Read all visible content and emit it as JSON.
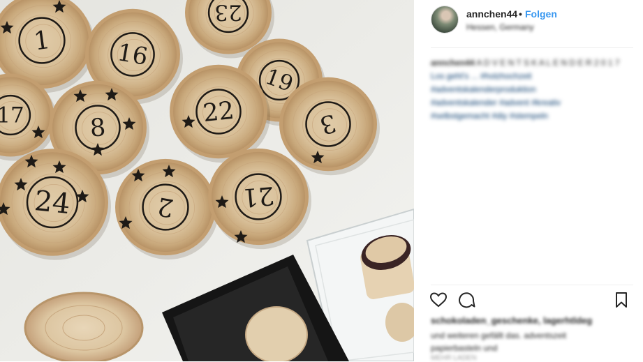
{
  "photo": {
    "alt_semantic": "wooden advent calendar number discs with stamp and ink pad"
  },
  "discs": [
    {
      "number": "1"
    },
    {
      "number": "16"
    },
    {
      "number": "23"
    },
    {
      "number": "19"
    },
    {
      "number": "17"
    },
    {
      "number": "8"
    },
    {
      "number": "22"
    },
    {
      "number": "3"
    },
    {
      "number": "24"
    },
    {
      "number": "2"
    },
    {
      "number": "21"
    }
  ],
  "header": {
    "username": "annchen44",
    "separator": "•",
    "follow_label": "Folgen",
    "location": "Hessen, Germany"
  },
  "caption": {
    "username": "annchen44",
    "title": "A D V E N T S K A L E N D E R 2 0 1 7",
    "lines": [
      "Los geht's ... #holzhochzeit",
      "#adventskalenderproduktion",
      "#adventskalender #advent #kreativ",
      "#selbstgemacht #diy #stempeln"
    ]
  },
  "footer": {
    "likes_text": "schokoladen_geschenke, lagerhtldeg",
    "liked_text": "und weiteren gefällt das. adventszeit papierbasteln und",
    "more_text": "MEHR LADEN"
  },
  "colors": {
    "follow": "#3897f0",
    "hashtag": "#003569",
    "text": "#262626"
  },
  "icons": [
    "heart-icon",
    "comment-icon",
    "bookmark-icon"
  ]
}
